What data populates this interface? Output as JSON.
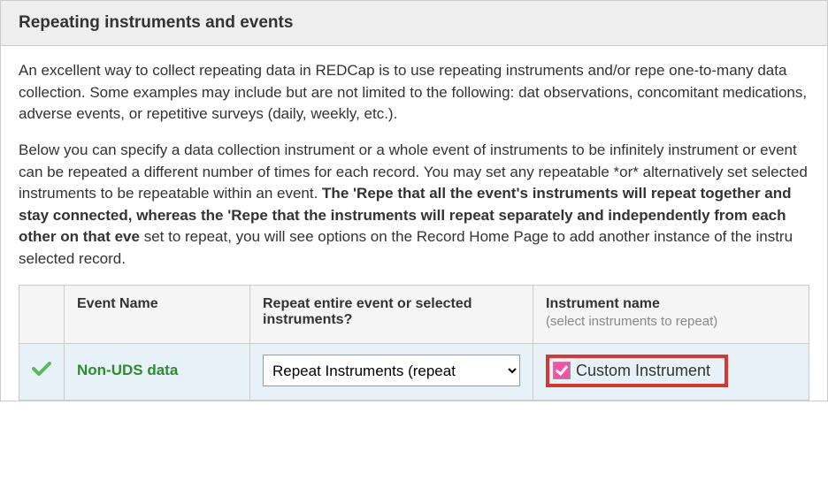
{
  "header": {
    "title": "Repeating instruments and events"
  },
  "description": {
    "para1": "An excellent way to collect repeating data in REDCap is to use repeating instruments and/or repe one-to-many data collection. Some examples may include but are not limited to the following: dat observations, concomitant medications, adverse events, or repetitive surveys (daily, weekly, etc.).",
    "para2a": "Below you can specify a data collection instrument or a whole event of instruments to be infinitely instrument or event can be repeated a different number of times for each record. You may set any repeatable *or* alternatively set selected instruments to be repeatable within an event. ",
    "para2bold": "The 'Repe that all the event's instruments will repeat together and stay connected, whereas the 'Repe that the instruments will repeat separately and independently from each other on that eve",
    "para2b": " set to repeat, you will see options on the Record Home Page to add another instance of the instru selected record."
  },
  "table": {
    "headers": {
      "event_name": "Event Name",
      "repeat_mode": "Repeat entire event or selected instruments?",
      "instrument_name": "Instrument name",
      "instrument_sub": "(select instruments to repeat)"
    },
    "rows": [
      {
        "checked": true,
        "event_label": "Non-UDS data",
        "repeat_option": "Repeat Instruments (repeat",
        "instrument_label": "Custom Instrument",
        "instrument_checked": true
      }
    ]
  }
}
